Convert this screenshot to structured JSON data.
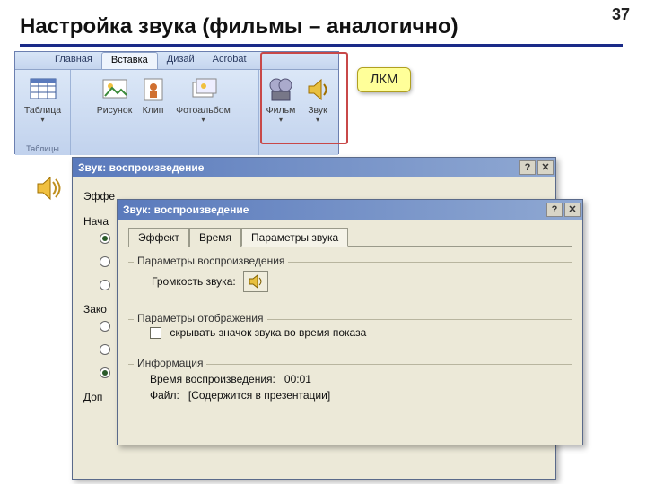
{
  "page_number": "37",
  "title": "Настройка звука (фильмы – аналогично)",
  "callout": "ЛКМ",
  "ribbon": {
    "tabs": [
      "Главная",
      "Вставка",
      "Дизай",
      "Acrobat"
    ],
    "active_tab_index": 1,
    "buttons": {
      "table": "Таблица",
      "picture": "Рисунок",
      "clip": "Клип",
      "album": "Фотоальбом",
      "movie": "Фильм",
      "sound": "Звук"
    },
    "group_label": "Таблицы"
  },
  "dialog_back": {
    "title": "Звук: воспроизведение",
    "labels": {
      "effect": "Эффе",
      "start": "Нача",
      "end": "Зако",
      "extra": "Доп"
    }
  },
  "dialog_front": {
    "title": "Звук: воспроизведение",
    "tabs": [
      "Эффект",
      "Время",
      "Параметры звука"
    ],
    "active_tab_index": 2,
    "fieldset_playback": "Параметры воспроизведения",
    "volume_label_pre": "Г",
    "volume_label_rest": "ромкость звука:",
    "fieldset_display": "Параметры отображения",
    "hide_icon_label": "скрывать значок звука во время показа",
    "fieldset_info": "Информация",
    "info_duration_label": "Время воспроизведения:",
    "info_duration_value": "00:01",
    "info_file_label": "Файл:",
    "info_file_value": "[Содержится в презентации]"
  }
}
